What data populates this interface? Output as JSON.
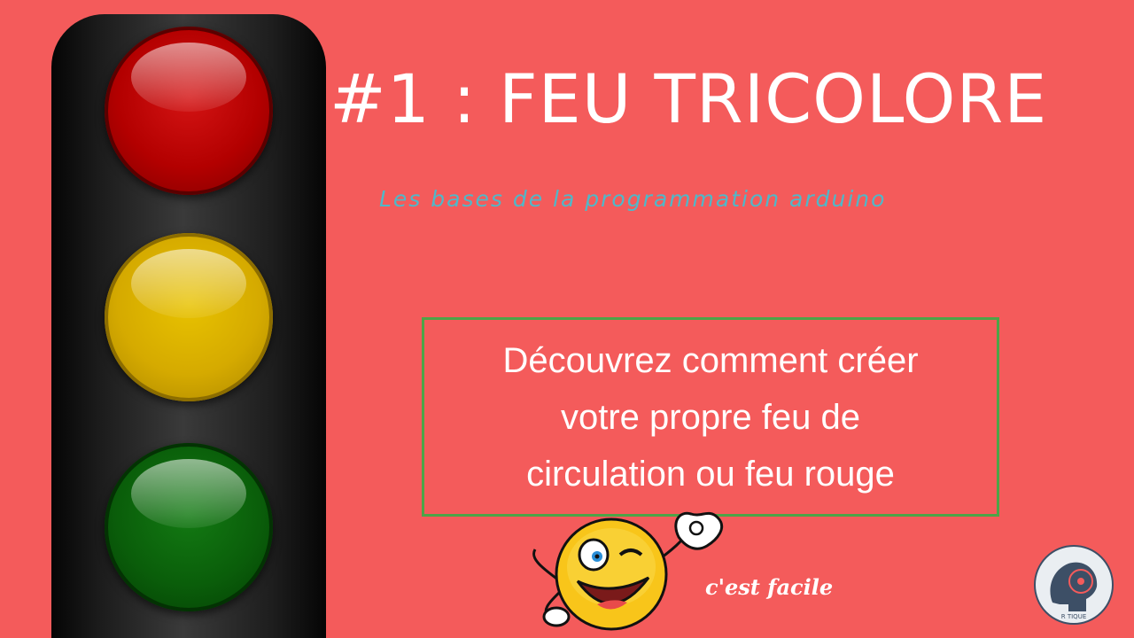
{
  "colors": {
    "background": "#f45b5b",
    "title": "#ffffff",
    "subtitle": "#4fb8c9",
    "box_border": "#4da447",
    "lamp_red": "#b30000",
    "lamp_yellow": "#d5aa00",
    "lamp_green": "#0a5e0a"
  },
  "title": "#1 : FEU TRICOLORE",
  "subtitle": "Les bases de la programmation arduino",
  "description": {
    "lines": [
      "Découvrez comment créer",
      "votre propre feu de",
      "circulation ou feu rouge"
    ]
  },
  "tagline": "c'est facile",
  "logo": {
    "text": "R  TIQUE",
    "icon": "brain-head-icon"
  },
  "icons": {
    "traffic_light": "traffic-light-icon",
    "smiley": "winking-smiley-icon"
  }
}
